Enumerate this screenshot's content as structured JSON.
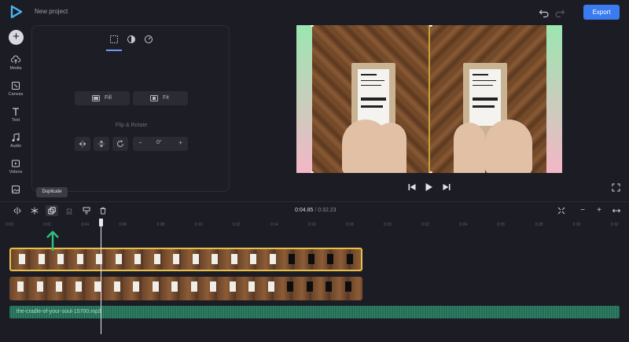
{
  "header": {
    "project_title": "New project",
    "export_label": "Export"
  },
  "sidebar": {
    "add_label": "+",
    "items": [
      {
        "label": "Media",
        "icon": "cloud-upload-icon"
      },
      {
        "label": "Canvas",
        "icon": "canvas-icon"
      },
      {
        "label": "Text",
        "icon": "text-icon"
      },
      {
        "label": "Audio",
        "icon": "music-icon"
      },
      {
        "label": "Videos",
        "icon": "video-icon"
      },
      {
        "label": "",
        "icon": "image-icon"
      }
    ]
  },
  "panel": {
    "tabs": [
      "crop-grid-icon",
      "color-adjust-icon",
      "speed-icon"
    ],
    "fill_label": "Fill",
    "fit_label": "Fit",
    "flip_rotate_label": "Flip & Rotate",
    "rotation_value": "0°",
    "minus": "−",
    "plus": "+"
  },
  "timeline": {
    "tooltip": "Duplicate",
    "current_time": "0:04.85",
    "separator": "/",
    "total_time": "0:32.23",
    "zoom_out": "−",
    "zoom_in": "+",
    "ruler_ticks": [
      "0:00",
      "0:02",
      "0:04",
      "0:06",
      "0:08",
      "0:10",
      "0:12",
      "0:14",
      "0:16",
      "0:18",
      "0:20",
      "0:22",
      "0:24",
      "0:26",
      "0:28",
      "0:30",
      "0:32"
    ],
    "audio_track_label": "the-cradle-of-your-soul-15700.mp3"
  },
  "colors": {
    "accent": "#3a7bf0",
    "selected_clip_border": "#e8c04a",
    "audio_track": "#246b55",
    "marker": "#2ec27e"
  }
}
